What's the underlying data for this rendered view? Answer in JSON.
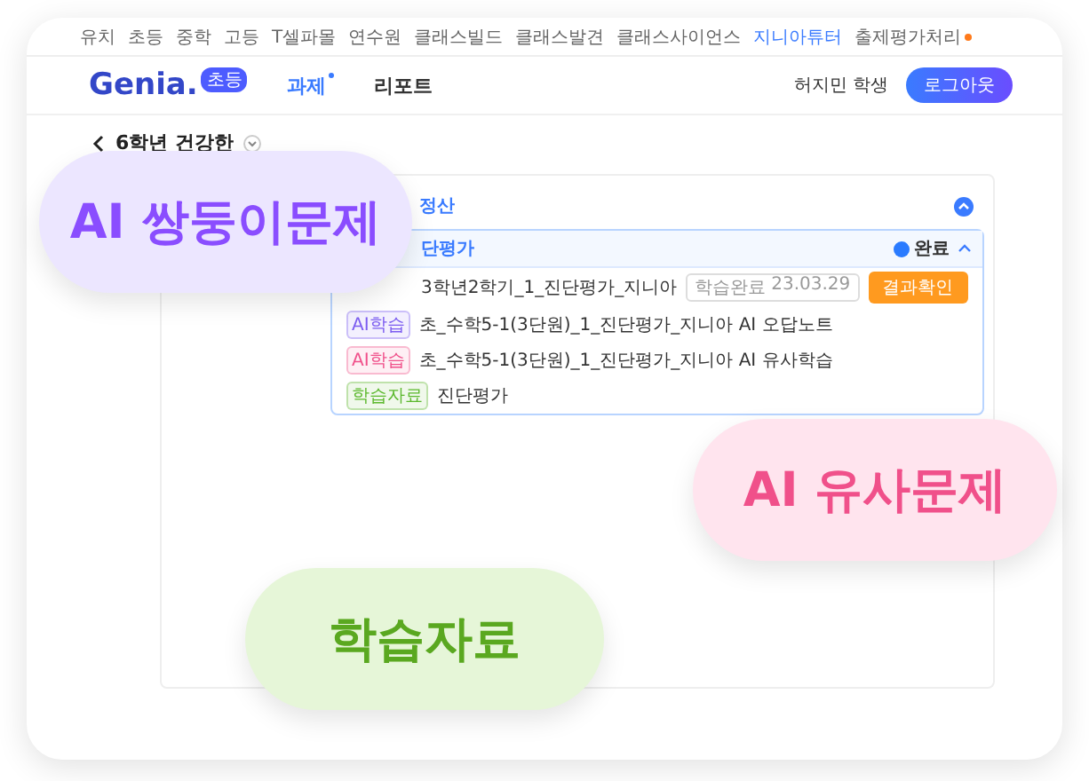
{
  "nav_links": [
    {
      "label": "유치",
      "selected": false,
      "new": false
    },
    {
      "label": "초등",
      "selected": false,
      "new": false
    },
    {
      "label": "중학",
      "selected": false,
      "new": false
    },
    {
      "label": "고등",
      "selected": false,
      "new": false
    },
    {
      "label": "T셀파몰",
      "selected": false,
      "new": false
    },
    {
      "label": "연수원",
      "selected": false,
      "new": false
    },
    {
      "label": "클래스빌드",
      "selected": false,
      "new": false
    },
    {
      "label": "클래스발견",
      "selected": false,
      "new": false
    },
    {
      "label": "클래스사이언스",
      "selected": false,
      "new": false
    },
    {
      "label": "지니아튜터",
      "selected": true,
      "new": false
    },
    {
      "label": "출제평가처리",
      "selected": false,
      "new": true
    }
  ],
  "logo": {
    "text": "Genia.",
    "badge": "초등"
  },
  "tabs": [
    {
      "label": "과제",
      "selected": true
    },
    {
      "label": "리포트",
      "selected": false
    }
  ],
  "user": "허지민 학생",
  "logout": "로그아웃",
  "breadcrumb": {
    "title": "6학년 건강한"
  },
  "section": {
    "title": "정산",
    "expanded": true
  },
  "group": {
    "title": "단평가",
    "status": "완료",
    "expanded": true
  },
  "items": [
    {
      "title": "3학년2학기_1_진단평가_지니아",
      "status_label": "학습완료",
      "status_date": "23.03.29",
      "action": "결과확인"
    },
    {
      "tag": "AI학습",
      "color": "#7b5cf0",
      "title": "초_수학5-1(3단원)_1_진단평가_지니아 AI 오답노트"
    },
    {
      "tag": "AI학습",
      "color": "#f0508a",
      "title": "초_수학5-1(3단원)_1_진단평가_지니아 AI 유사학습"
    },
    {
      "tag": "학습자료",
      "color": "#5cb82e",
      "title": "진단평가"
    }
  ],
  "bubbles": [
    {
      "text": "AI 쌍둥이문제",
      "color": "#8a4dff"
    },
    {
      "text": "AI 유사문제",
      "color": "#f0508a"
    },
    {
      "text": "학습자료",
      "color": "#5aa820"
    }
  ]
}
